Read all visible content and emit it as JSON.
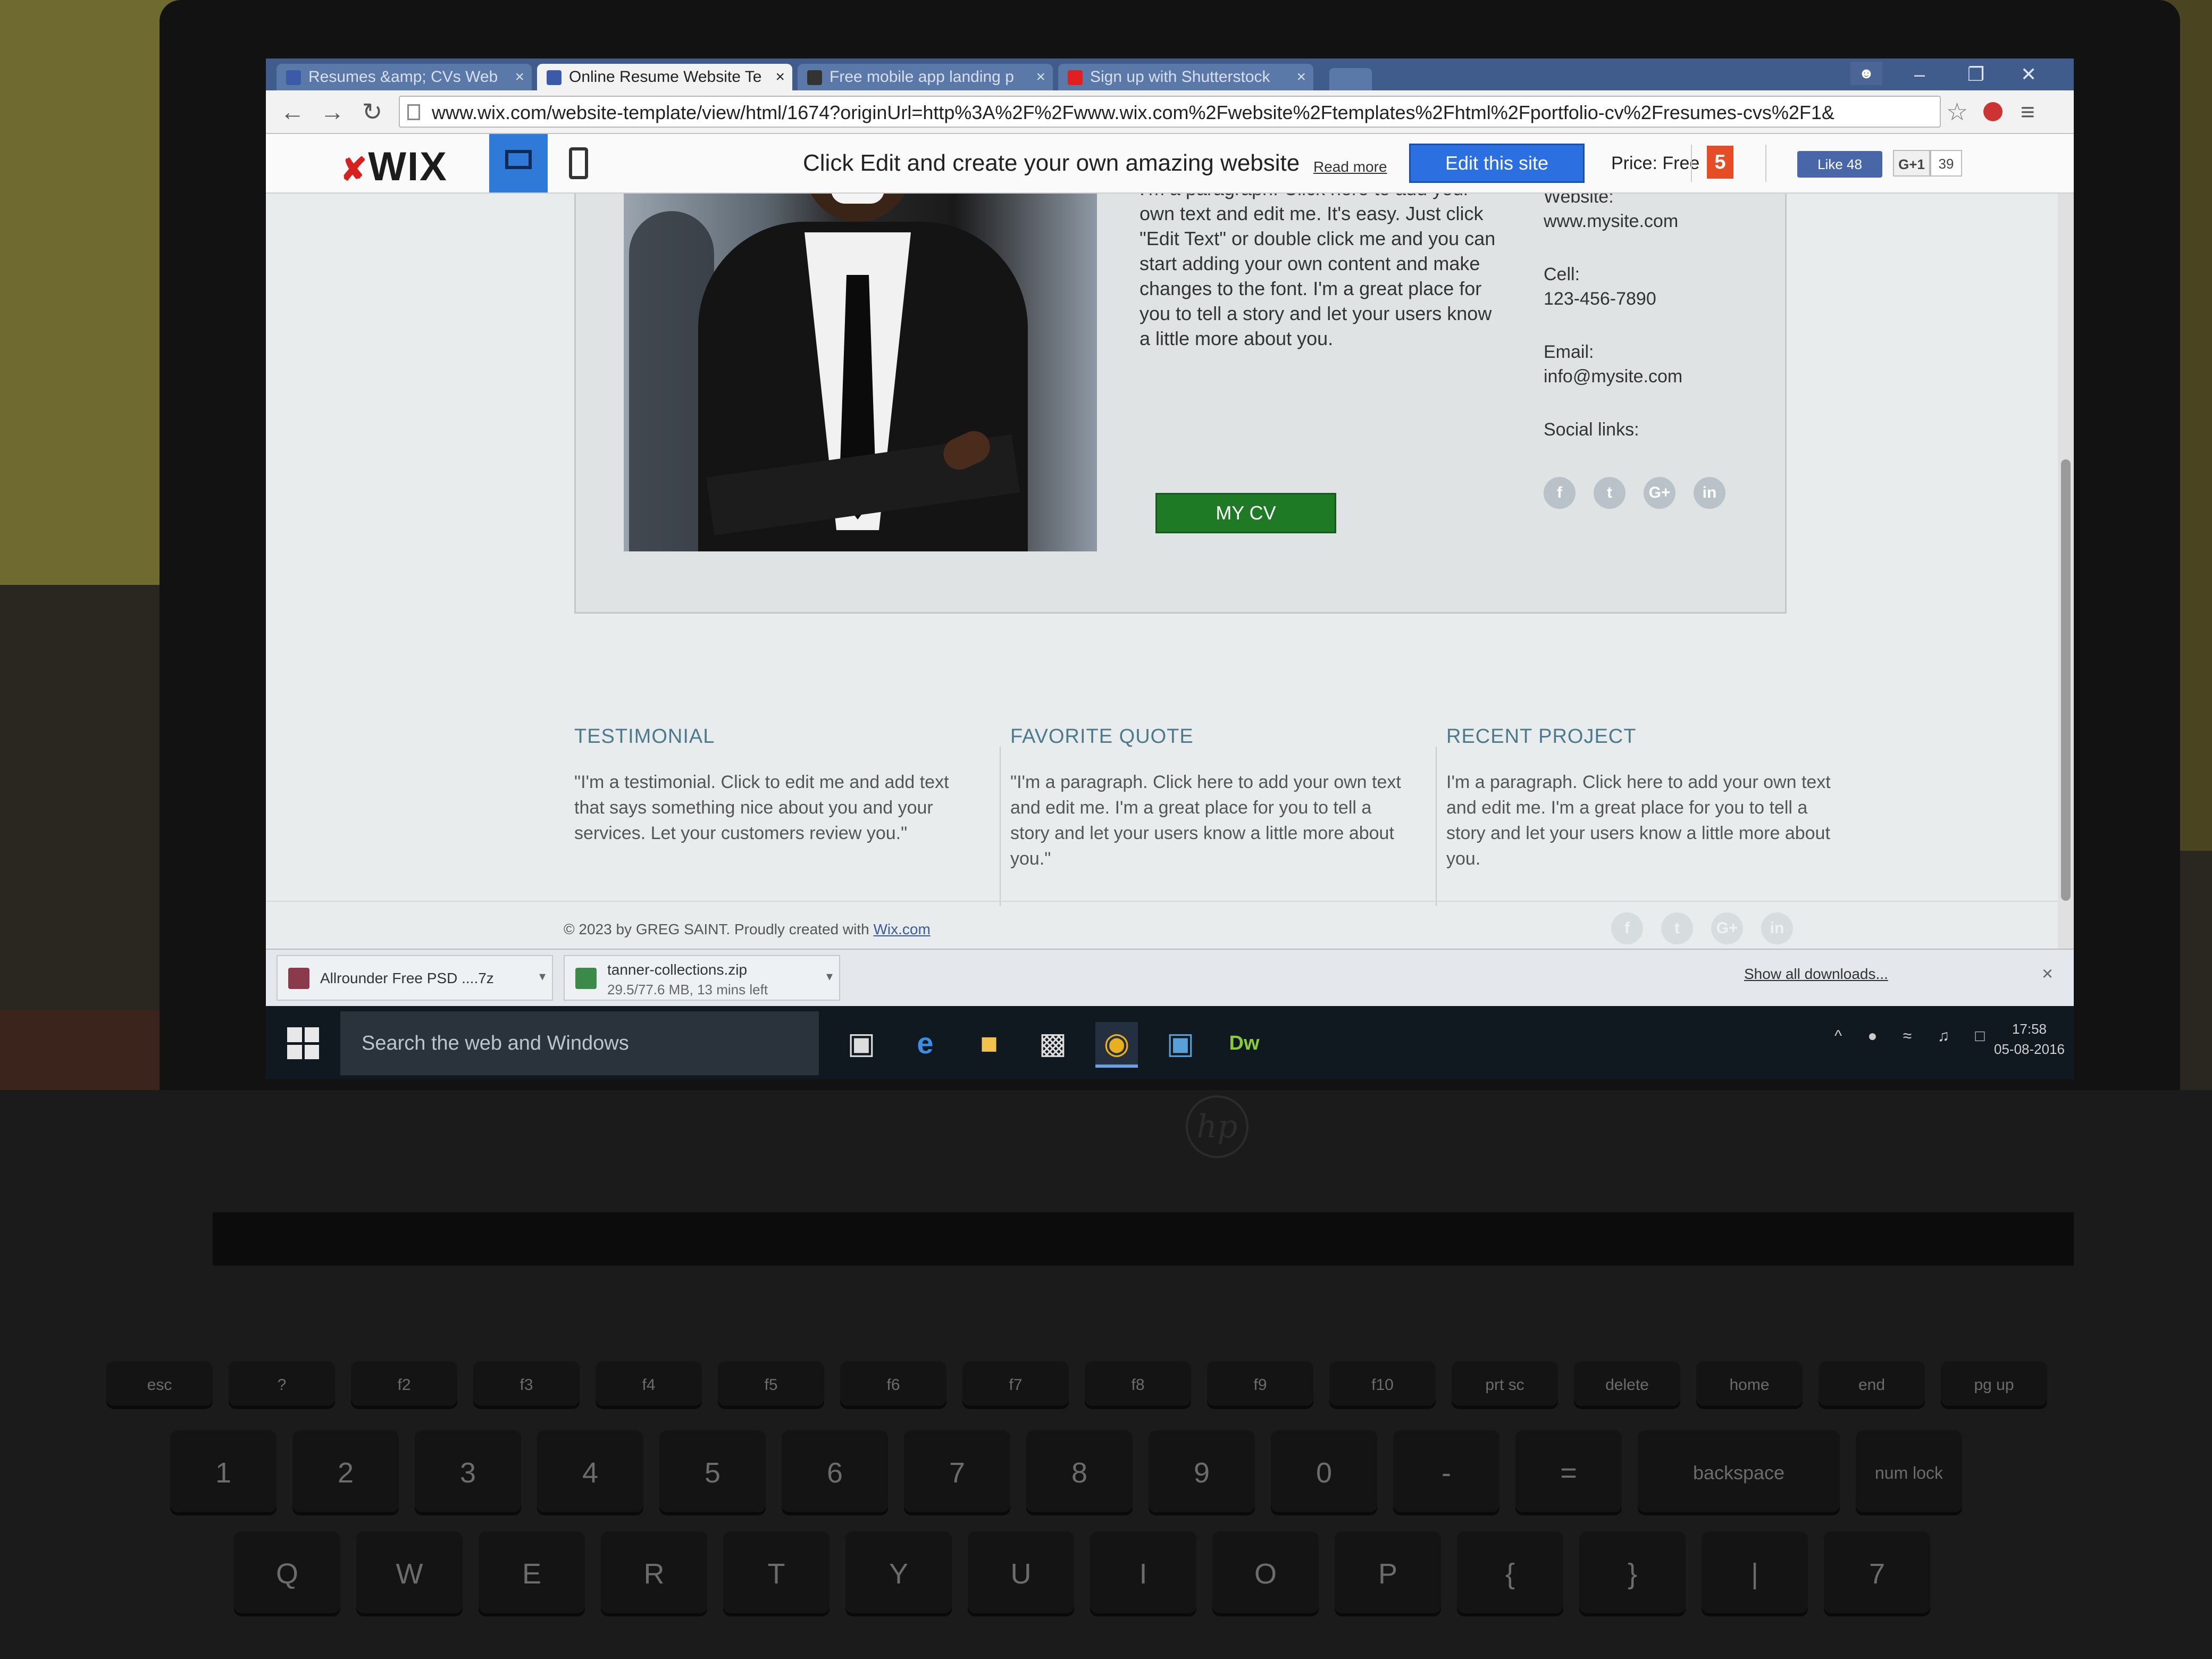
{
  "browser": {
    "tabs": [
      {
        "title": "Resumes &amp; CVs Web",
        "favicon_color": "#3b5ba8"
      },
      {
        "title": "Online Resume Website Te",
        "favicon_color": "#3b5ba8"
      },
      {
        "title": "Free mobile app landing p",
        "favicon_color": "#333333"
      },
      {
        "title": "Sign up with Shutterstock",
        "favicon_color": "#e02020"
      }
    ],
    "url": "www.wix.com/website-template/view/html/1674?originUrl=http%3A%2F%2Fwww.wix.com%2Fwebsite%2Ftemplates%2Fhtml%2Fportfolio-cv%2Fresumes-cvs%2F1&"
  },
  "wix_bar": {
    "logo": "WIX",
    "promo": "Click Edit and create your own amazing website",
    "read_more": "Read more",
    "edit_button": "Edit this site",
    "price": "Price: Free",
    "html5_badge": "5",
    "like": "Like 48",
    "gplus": "G+1",
    "gplus_count": "39"
  },
  "page": {
    "intro": "I'm a paragraph. Click here to add your own text and edit me. It's easy. Just click \"Edit Text\" or double click me and you can start adding your own content and make changes to the font. I'm a great place for you to tell a story and let your users know a little more about you.",
    "cv_button": "MY CV",
    "contact": {
      "website_label": "Website:",
      "website": "www.mysite.com",
      "cell_label": "Cell:",
      "cell": "123-456-7890",
      "email_label": "Email:",
      "email": "info@mysite.com",
      "social_label": "Social links:"
    },
    "social_icons": [
      "f",
      "t",
      "G+",
      "in"
    ],
    "columns": [
      {
        "heading": "TESTIMONIAL",
        "text": "\"I'm a testimonial. Click to edit me and add text that says something nice about you and your services. Let your customers review you.\""
      },
      {
        "heading": "FAVORITE QUOTE",
        "text": "\"I'm a paragraph. Click here to add your own text and edit me. I'm a great place for you to tell a story and let your users know a little more about you.\""
      },
      {
        "heading": "RECENT PROJECT",
        "text": "I'm a paragraph. Click here to add your own text and edit me. I'm a great place for you to tell a story and let your users know a little more about you."
      }
    ],
    "footer": {
      "copyright": "© 2023 by GREG SAINT. Proudly created with ",
      "link": "Wix.com"
    }
  },
  "downloads": {
    "items": [
      {
        "name": "Allrounder Free PSD ....7z",
        "status": ""
      },
      {
        "name": "tanner-collections.zip",
        "status": "29.5/77.6 MB, 13 mins left"
      }
    ],
    "show_all": "Show all downloads..."
  },
  "taskbar": {
    "search_placeholder": "Search the web and Windows",
    "time": "17:58",
    "date": "05-08-2016",
    "apps": [
      "task-view",
      "edge",
      "file-explorer",
      "store",
      "chrome",
      "photos",
      "dreamweaver"
    ]
  },
  "laptop": {
    "brand": "hp",
    "key_labels": [
      "esc",
      "?",
      "f2",
      "f3",
      "f4",
      "f5",
      "f6",
      "f7",
      "f8",
      "f9",
      "f10",
      "prt sc",
      "delete",
      "home",
      "end",
      "pg up",
      "!",
      "@",
      "#",
      "$",
      "%",
      "^",
      "&",
      "(",
      ")",
      "_",
      "+",
      "backspace",
      "num lock",
      "Q",
      "W",
      "E",
      "R",
      "T",
      "Y",
      "U",
      "I",
      "O",
      "P",
      "{",
      "}",
      "|",
      "7",
      "8"
    ],
    "row2": [
      "1",
      "2",
      "3",
      "4",
      "5",
      "6",
      "7",
      "8",
      "9",
      "0",
      "-",
      "="
    ]
  }
}
